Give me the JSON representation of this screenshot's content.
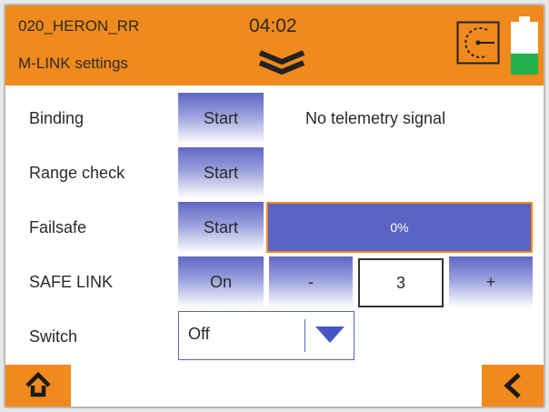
{
  "header": {
    "model_name": "020_HERON_RR",
    "screen_title": "M-LINK settings",
    "clock": "04:02"
  },
  "colors": {
    "accent": "#f08a1c",
    "button": "#6067c4",
    "battery": "#22b14c"
  },
  "icons": [
    "chevron-down-icon",
    "timer-icon",
    "battery-icon",
    "home-icon",
    "back-icon",
    "dropdown-arrow-icon"
  ],
  "battery": {
    "level_percent": 40
  },
  "rows": {
    "binding": {
      "label": "Binding",
      "button": "Start",
      "status": "No telemetry signal"
    },
    "range_check": {
      "label": "Range check",
      "button": "Start"
    },
    "failsafe": {
      "label": "Failsafe",
      "button": "Start",
      "progress_text": "0%",
      "progress_percent": 0
    },
    "safe_link": {
      "label": "SAFE LINK",
      "button": "On",
      "decrement": "-",
      "value": "3",
      "increment": "+"
    },
    "switch": {
      "label": "Switch",
      "selected": "Off"
    }
  }
}
